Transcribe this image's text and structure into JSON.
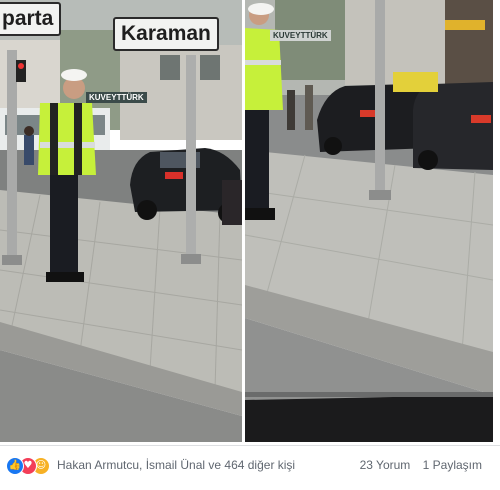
{
  "photo_left": {
    "sign_left_text": "parta",
    "sign_right_text": "Karaman",
    "store_sign_text": "KUVEYTTÜRK"
  },
  "photo_right": {
    "store_sign_text": "KUVEYTTÜRK"
  },
  "footer": {
    "reaction_icons": [
      "like-icon",
      "love-icon",
      "haha-icon"
    ],
    "likers_text": "Hakan Armutcu, İsmail Ünal ve 464 diğer kişi",
    "comments_text": "23 Yorum",
    "shares_text": "1 Paylaşım"
  },
  "colors": {
    "like": "#1877f2",
    "love": "#f33e58",
    "haha": "#f7b125",
    "vest": "#c6f03a"
  }
}
